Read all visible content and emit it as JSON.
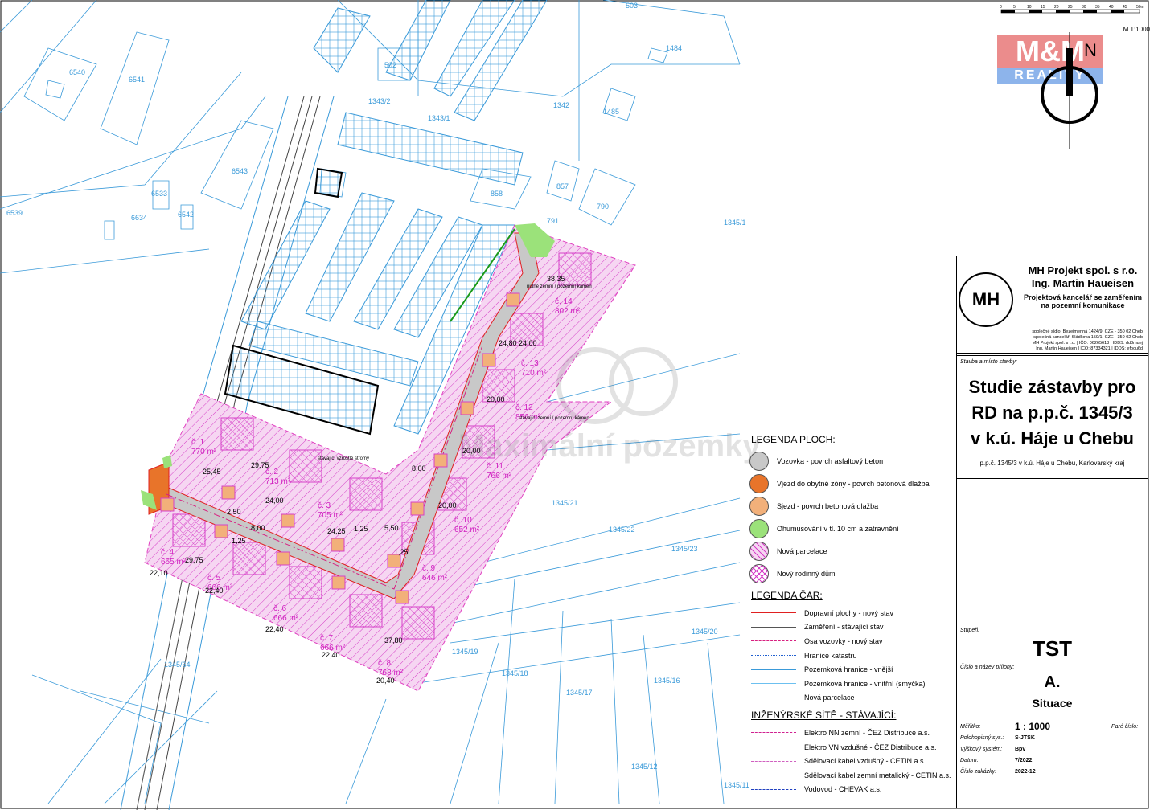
{
  "map": {
    "parcels_blue": [
      "503",
      "1484",
      "6540",
      "6541",
      "502",
      "1343/2",
      "1343/1",
      "1342",
      "1485",
      "6543",
      "6533",
      "6634",
      "6542",
      "6539",
      "858",
      "857",
      "790",
      "791",
      "1345/21",
      "1345/22",
      "1345/23",
      "1345/20",
      "1345/19",
      "1345/18",
      "1345/17",
      "1345/16",
      "1345/64",
      "1345/12",
      "1345/11",
      "1345/1"
    ],
    "new_parcels": [
      {
        "name": "č. 1",
        "area": "770 m²"
      },
      {
        "name": "č. 2",
        "area": "713 m²"
      },
      {
        "name": "č. 3",
        "area": "705 m²"
      },
      {
        "name": "č. 4",
        "area": "665 m²"
      },
      {
        "name": "č. 5",
        "area": "666 m²"
      },
      {
        "name": "č. 6",
        "area": "666 m²"
      },
      {
        "name": "č. 7",
        "area": "666 m²"
      },
      {
        "name": "č. 8",
        "area": "768 m²"
      },
      {
        "name": "č. 9",
        "area": "646 m²"
      },
      {
        "name": "č. 10",
        "area": "652 m²"
      },
      {
        "name": "č. 11",
        "area": "766 m²"
      },
      {
        "name": "č. 12",
        "area": "856 m²"
      },
      {
        "name": "č. 13",
        "area": "710 m²"
      },
      {
        "name": "č. 14",
        "area": "802 m²"
      }
    ],
    "dimensions": [
      "25,45",
      "29,75",
      "24,00",
      "24,25",
      "1,25",
      "8,00",
      "5,50",
      "2,50",
      "1,25",
      "29,75",
      "22,10",
      "22,40",
      "22,40",
      "22,40",
      "37,80",
      "20,40",
      "24,80",
      "20,00",
      "20,00",
      "20,00",
      "24,00",
      "8,00",
      "38,35",
      "1,25"
    ],
    "notes": [
      "nutné zemní / pozemní kámen",
      "stávající zemní / pozemní kámen",
      "stávající vzrostlé stromy"
    ],
    "watermark": "Maximální pozemky"
  },
  "legend": {
    "areas_title": "LEGENDA PLOCH:",
    "areas": [
      {
        "label": "Vozovka - povrch asfaltový beton",
        "color": "#c8c8c8"
      },
      {
        "label": "Vjezd do obytné zóny - povrch betonová dlažba",
        "color": "#e8742a"
      },
      {
        "label": "Sjezd - povrch betonová dlažba",
        "color": "#f2b07a"
      },
      {
        "label": "Ohumusování v tl. 10 cm a zatravnění",
        "color": "#9be27a"
      },
      {
        "label": "Nová parcelace",
        "color": "pattern-hatch"
      },
      {
        "label": "Nový rodinný dům",
        "color": "pattern-cross"
      }
    ],
    "lines_title": "LEGENDA ČAR:",
    "lines": [
      {
        "label": "Dopravní plochy - nový stav",
        "color": "#e02020",
        "style": "solid"
      },
      {
        "label": "Zaměření - stávající stav",
        "color": "#555555",
        "style": "solid"
      },
      {
        "label": "Osa vozovky - nový stav",
        "color": "#d82080",
        "style": "dashdot"
      },
      {
        "label": "Hranice katastru",
        "color": "#2060d0",
        "style": "dotted"
      },
      {
        "label": "Pozemková hranice - vnější",
        "color": "#3a9ad9",
        "style": "solid"
      },
      {
        "label": "Pozemková hranice - vnitřní (smyčka)",
        "color": "#6cc0f0",
        "style": "thin"
      },
      {
        "label": "Nová parcelace",
        "color": "#e040c0",
        "style": "dashed"
      }
    ],
    "networks_title": "INŽENÝRSKÉ SÍTĚ - STÁVAJÍCÍ:",
    "networks": [
      {
        "label": "Elektro NN zemní - ČEZ Distribuce a.s.",
        "color": "#d02090"
      },
      {
        "label": "Elektro VN vzdušné - ČEZ Distribuce a.s.",
        "color": "#d02090"
      },
      {
        "label": "Sdělovací kabel vzdušný - CETIN a.s.",
        "color": "#d060c0"
      },
      {
        "label": "Sdělovací kabel zemní metalický - CETIN a.s.",
        "color": "#b040d0"
      },
      {
        "label": "Vodovod - CHEVAK a.s.",
        "color": "#2040c0"
      }
    ]
  },
  "scale": {
    "ticks": [
      "0",
      "5",
      "10",
      "15",
      "20",
      "25",
      "30",
      "35",
      "40",
      "45",
      "50m"
    ],
    "label": "M 1:1000"
  },
  "brand": {
    "logo_text": "M&M",
    "logo_sub": "REALITY"
  },
  "titleblock": {
    "company_line1": "MH Projekt spol. s r.o.",
    "company_line2": "Ing. Martin Haueisen",
    "company_desc1": "Projektová kancelář se zaměřením",
    "company_desc2": "na pozemní komunikace",
    "addr1": "společné sídlo: Bezejmenná 1424/9, CZE - 350 02 Cheb",
    "addr2": "společná kancelář: Sládkova 159/1, CZE - 350 02 Cheb",
    "addr3": "MH Projekt spol. s r.o. | IČO: 06265618 | IDDS: dd8muej",
    "addr4": "Ing. Martin Haueisen | IČO: 87334321 | IDDS: efocu6d",
    "stavba_label": "Stavba a místo stavby:",
    "title1": "Studie zástavby pro",
    "title2": "RD na p.p.č. 1345/3",
    "title3": "v k.ú. Háje u Chebu",
    "location": "p.p.č. 1345/3 v k.ú. Háje u Chebu, Karlovarský kraj",
    "stupen_label": "Stupeň:",
    "stupen": "TST",
    "priloha_label": "Číslo a název přílohy:",
    "priloha": "A.",
    "priloha_name": "Situace",
    "meritko_label": "Měřítko:",
    "meritko": "1 : 1000",
    "pare_label": "Paré číslo:",
    "polohopis_label": "Polohopisný sys.:",
    "polohopis": "S-JTSK",
    "vyskovy_label": "Výškový systém:",
    "vyskovy": "Bpv",
    "datum_label": "Datum:",
    "datum": "7/2022",
    "zakazka_label": "Číslo zakázky:",
    "zakazka": "2022-12"
  }
}
